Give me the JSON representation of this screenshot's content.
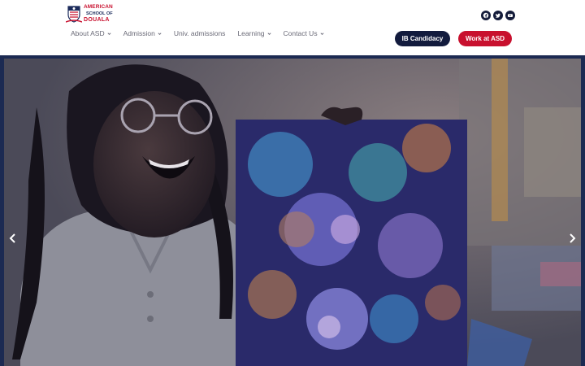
{
  "logo": {
    "line1": "AMERICAN",
    "line2": "SCHOOL OF",
    "line3": "DOUALA"
  },
  "social": [
    {
      "icon": "facebook-icon"
    },
    {
      "icon": "twitter-icon"
    },
    {
      "icon": "youtube-icon"
    }
  ],
  "nav": {
    "items": [
      {
        "label": "About ASD",
        "dropdown": true
      },
      {
        "label": "Admission",
        "dropdown": true
      },
      {
        "label": "Univ. admissions",
        "dropdown": false
      },
      {
        "label": "Learning",
        "dropdown": true
      },
      {
        "label": "Contact Us",
        "dropdown": true
      }
    ]
  },
  "buttons": {
    "ib_label": "IB Candidacy",
    "work_label": "Work at ASD"
  },
  "colors": {
    "brand_red": "#c8102e",
    "brand_navy": "#121b3d"
  },
  "hero": {
    "icons": [
      "chevron-left-icon",
      "chevron-right-icon"
    ]
  }
}
